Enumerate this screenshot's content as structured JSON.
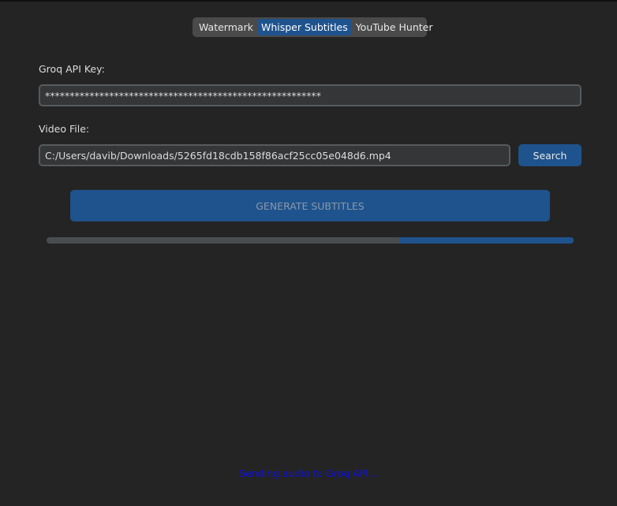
{
  "tabs": [
    {
      "label": "Watermark",
      "active": false
    },
    {
      "label": "Whisper Subtitles",
      "active": true
    },
    {
      "label": "YouTube Hunter",
      "active": false
    }
  ],
  "form": {
    "api_key_label": "Groq API Key:",
    "api_key_value": "********************************************************",
    "video_label": "Video File:",
    "video_value": "C:/Users/davib/Downloads/5265fd18cdb158f86acf25cc05e048d6.mp4",
    "search_label": "Search",
    "generate_label": "GENERATE SUBTITLES"
  },
  "progress": {
    "fill_start": 0.67,
    "fill_end": 1.0
  },
  "status": {
    "text": "Sending audio to Groq API..."
  },
  "colors": {
    "accent": "#1f538d",
    "background": "#242424",
    "status_text": "#1010e0"
  }
}
